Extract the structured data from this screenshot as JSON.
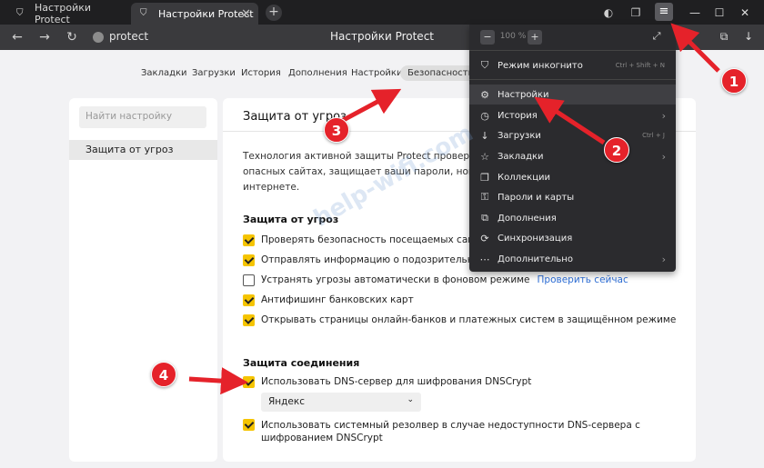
{
  "tabs": [
    {
      "label": "Настройки Protect"
    },
    {
      "label": "Настройки Protect"
    }
  ],
  "address": {
    "text": "protect",
    "title": "Настройки Protect"
  },
  "settings_nav": [
    "Закладки",
    "Загрузки",
    "История",
    "Дополнения",
    "Настройки",
    "Безопасность"
  ],
  "sidebar": {
    "search_placeholder": "Найти настройку",
    "item": "Защита от угроз"
  },
  "main": {
    "title": "Защита от угроз",
    "description": "Технология активной защиты Protect проверяет ска об опасных сайтах, защищает ваши пароли, номера работе в интернете.",
    "threat_section": "Защита от угроз",
    "threat_items": [
      {
        "label": "Проверять безопасность посещаемых сайтов и",
        "checked": true
      },
      {
        "label": "Отправлять информацию о подозрительных фа",
        "checked": true
      },
      {
        "label": "Устранять угрозы автоматически в фоновом режиме",
        "checked": false,
        "link": "Проверить сейчас"
      },
      {
        "label": "Антифишинг банковских карт",
        "checked": true
      },
      {
        "label": "Открывать страницы онлайн-банков и платежных систем в защищённом режиме",
        "checked": true
      }
    ],
    "conn_section": "Защита соединения",
    "dns_item": "Использовать DNS-сервер для шифрования DNSCrypt",
    "dns_select": "Яндекс",
    "resolver_item": "Использовать системный резолвер в случае недоступности DNS-сервера с шифрованием DNSCrypt"
  },
  "menu": {
    "zoom": "100 %",
    "items": [
      {
        "label": "Режим инкогнито",
        "shortcut": "Ctrl + Shift + N",
        "icon": "mask-icon"
      },
      {
        "label": "Настройки",
        "icon": "gear-icon"
      },
      {
        "label": "История",
        "icon": "clock-icon",
        "arrow": true
      },
      {
        "label": "Загрузки",
        "shortcut": "Ctrl + J",
        "icon": "download-icon"
      },
      {
        "label": "Закладки",
        "icon": "star-icon",
        "arrow": true
      },
      {
        "label": "Коллекции",
        "icon": "collections-icon"
      },
      {
        "label": "Пароли и карты",
        "icon": "key-icon"
      },
      {
        "label": "Дополнения",
        "icon": "puzzle-icon"
      },
      {
        "label": "Синхронизация",
        "icon": "sync-icon"
      },
      {
        "label": "Дополнительно",
        "icon": "more-icon",
        "arrow": true
      }
    ]
  },
  "annotations": [
    "1",
    "2",
    "3",
    "4"
  ],
  "watermark": "help-wifi.com",
  "colors": {
    "accent": "#f5c400",
    "badge": "#e5222a",
    "link": "#2f6fd6"
  }
}
